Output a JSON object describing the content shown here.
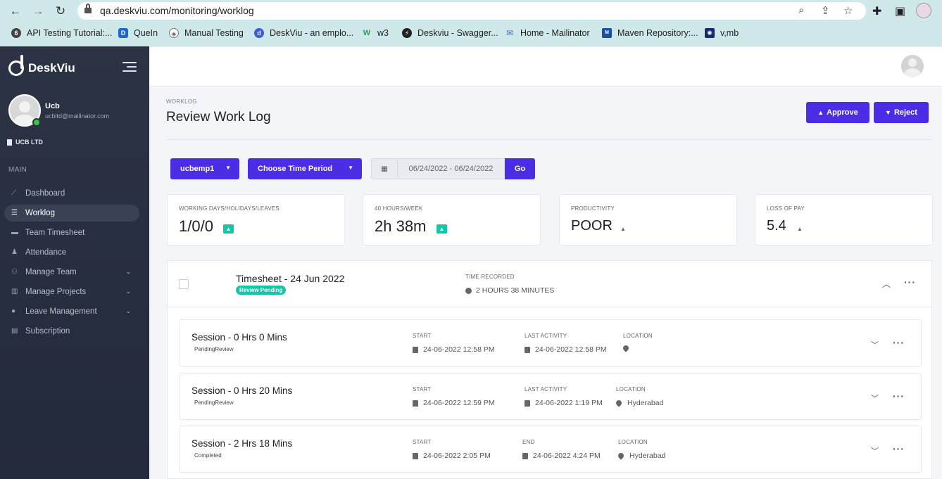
{
  "browser": {
    "url": "qa.deskviu.com/monitoring/worklog",
    "bookmarks": [
      {
        "label": "API Testing Tutorial:...",
        "color": "#444444",
        "glyph": "6"
      },
      {
        "label": "QueIn",
        "color": "#1f66d1",
        "glyph": "D"
      },
      {
        "label": "Manual Testing",
        "color": "#555555",
        "glyph": "◈"
      },
      {
        "label": "DeskViu - an emplo...",
        "color": "#3b5bdb",
        "glyph": "d"
      },
      {
        "label": "w3",
        "color": "#2e9d5c",
        "glyph": "W"
      },
      {
        "label": "Deskviu - Swagger...",
        "color": "#222222",
        "glyph": "⚡"
      },
      {
        "label": "Home - Mailinator",
        "color": "#3a73c9",
        "glyph": "✉"
      },
      {
        "label": "Maven Repository:...",
        "color": "#1f4fa3",
        "glyph": "M"
      },
      {
        "label": "v,mb",
        "color": "#1a2a6c",
        "glyph": "✺"
      }
    ]
  },
  "sidebar": {
    "brand": "DeskViu",
    "user_name": "Ucb",
    "user_email": "ucbltd@mailinator.com",
    "company": "UCB LTD",
    "section_label": "MAIN",
    "items": [
      {
        "label": "Dashboard",
        "icon": "chart-line-icon",
        "glyph": "⟋"
      },
      {
        "label": "Worklog",
        "icon": "list-icon",
        "glyph": "☰"
      },
      {
        "label": "Team Timesheet",
        "icon": "car-icon",
        "glyph": "▬"
      },
      {
        "label": "Attendance",
        "icon": "user-check-icon",
        "glyph": "♟"
      },
      {
        "label": "Manage Team",
        "icon": "users-icon",
        "glyph": "⚇"
      },
      {
        "label": "Manage Projects",
        "icon": "projects-icon",
        "glyph": "▥"
      },
      {
        "label": "Leave Management",
        "icon": "leave-icon",
        "glyph": "●"
      },
      {
        "label": "Subscription",
        "icon": "document-icon",
        "glyph": "▤"
      }
    ]
  },
  "page": {
    "breadcrumb": "WORKLOG",
    "title": "Review Work Log",
    "approve_label": "Approve",
    "reject_label": "Reject"
  },
  "filters": {
    "employee": "ucbemp1",
    "period": "Choose Time Period",
    "date_range": "06/24/2022 - 06/24/2022",
    "go_label": "Go"
  },
  "stats": [
    {
      "label": "WORKING DAYS/HOLIDAYS/LEAVES",
      "value": "1/0/0"
    },
    {
      "label": "40 HOURS/WEEK",
      "value": "2h 38m"
    },
    {
      "label": "PRODUCTIVITY",
      "value": "POOR"
    },
    {
      "label": "LOSS OF PAY",
      "value": "5.4"
    }
  ],
  "timesheet": {
    "title": "Timesheet - 24 Jun 2022",
    "badge": "Review Pending",
    "recorded_label": "TIME RECORDED",
    "recorded_value": "2 HOURS 38 MINUTES",
    "badge_color": "#12c6a8"
  },
  "sessions": [
    {
      "title": "Session - 0 Hrs 0 Mins",
      "status": "PendingReview",
      "start_label": "START",
      "start": "24-06-2022 12:58 PM",
      "second_label": "LAST ACTIVITY",
      "second": "24-06-2022 12:58 PM",
      "location_label": "LOCATION",
      "location": ""
    },
    {
      "title": "Session - 0 Hrs 20 Mins",
      "status": "PendingReview",
      "start_label": "START",
      "start": "24-06-2022 12:59 PM",
      "second_label": "LAST ACTIVITY",
      "second": "24-06-2022 1:19 PM",
      "location_label": "LOCATION",
      "location": "Hyderabad"
    },
    {
      "title": "Session - 2 Hrs 18 Mins",
      "status": "Completed",
      "start_label": "START",
      "start": "24-06-2022 2:05 PM",
      "second_label": "END",
      "second": "24-06-2022 4:24 PM",
      "location_label": "LOCATION",
      "location": "Hyderabad"
    }
  ],
  "colors": {
    "accent": "#4b2de6",
    "sidebar": "#2a3142",
    "success": "#12c6a8"
  }
}
